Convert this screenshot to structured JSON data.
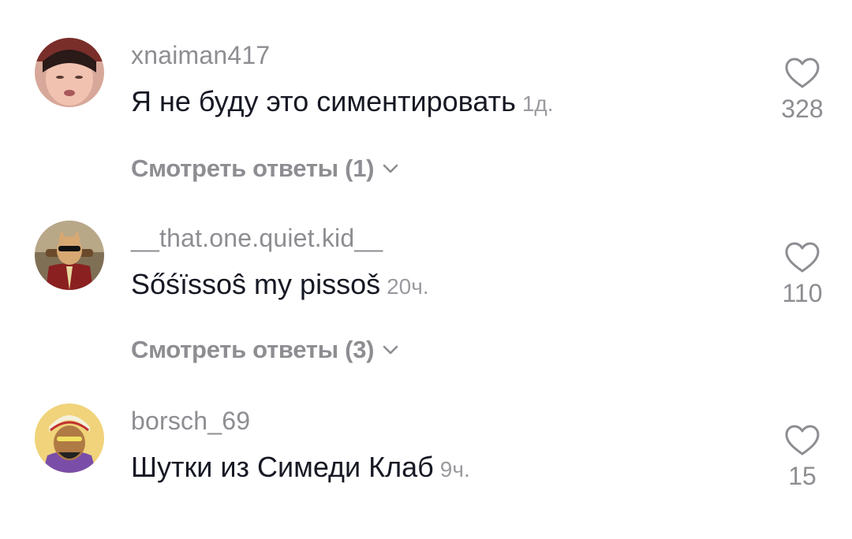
{
  "comments": [
    {
      "username": "xnaiman417",
      "text": "Я не буду это симентировать",
      "time": "1д.",
      "replies_label": "Смотреть ответы (1)",
      "likes": "328"
    },
    {
      "username": "__that.one.quiet.kid__",
      "text": "Sőśïssoŝ my pissoš",
      "time": "20ч.",
      "replies_label": "Смотреть ответы (3)",
      "likes": "110"
    },
    {
      "username": "borsch_69",
      "text": "Шутки из Симеди Клаб",
      "time": "9ч.",
      "likes": "15"
    }
  ],
  "icons": {
    "like": "heart-icon",
    "expand": "chevron-down-icon"
  },
  "colors": {
    "text": "#161823",
    "secondary": "#8d8d92"
  }
}
